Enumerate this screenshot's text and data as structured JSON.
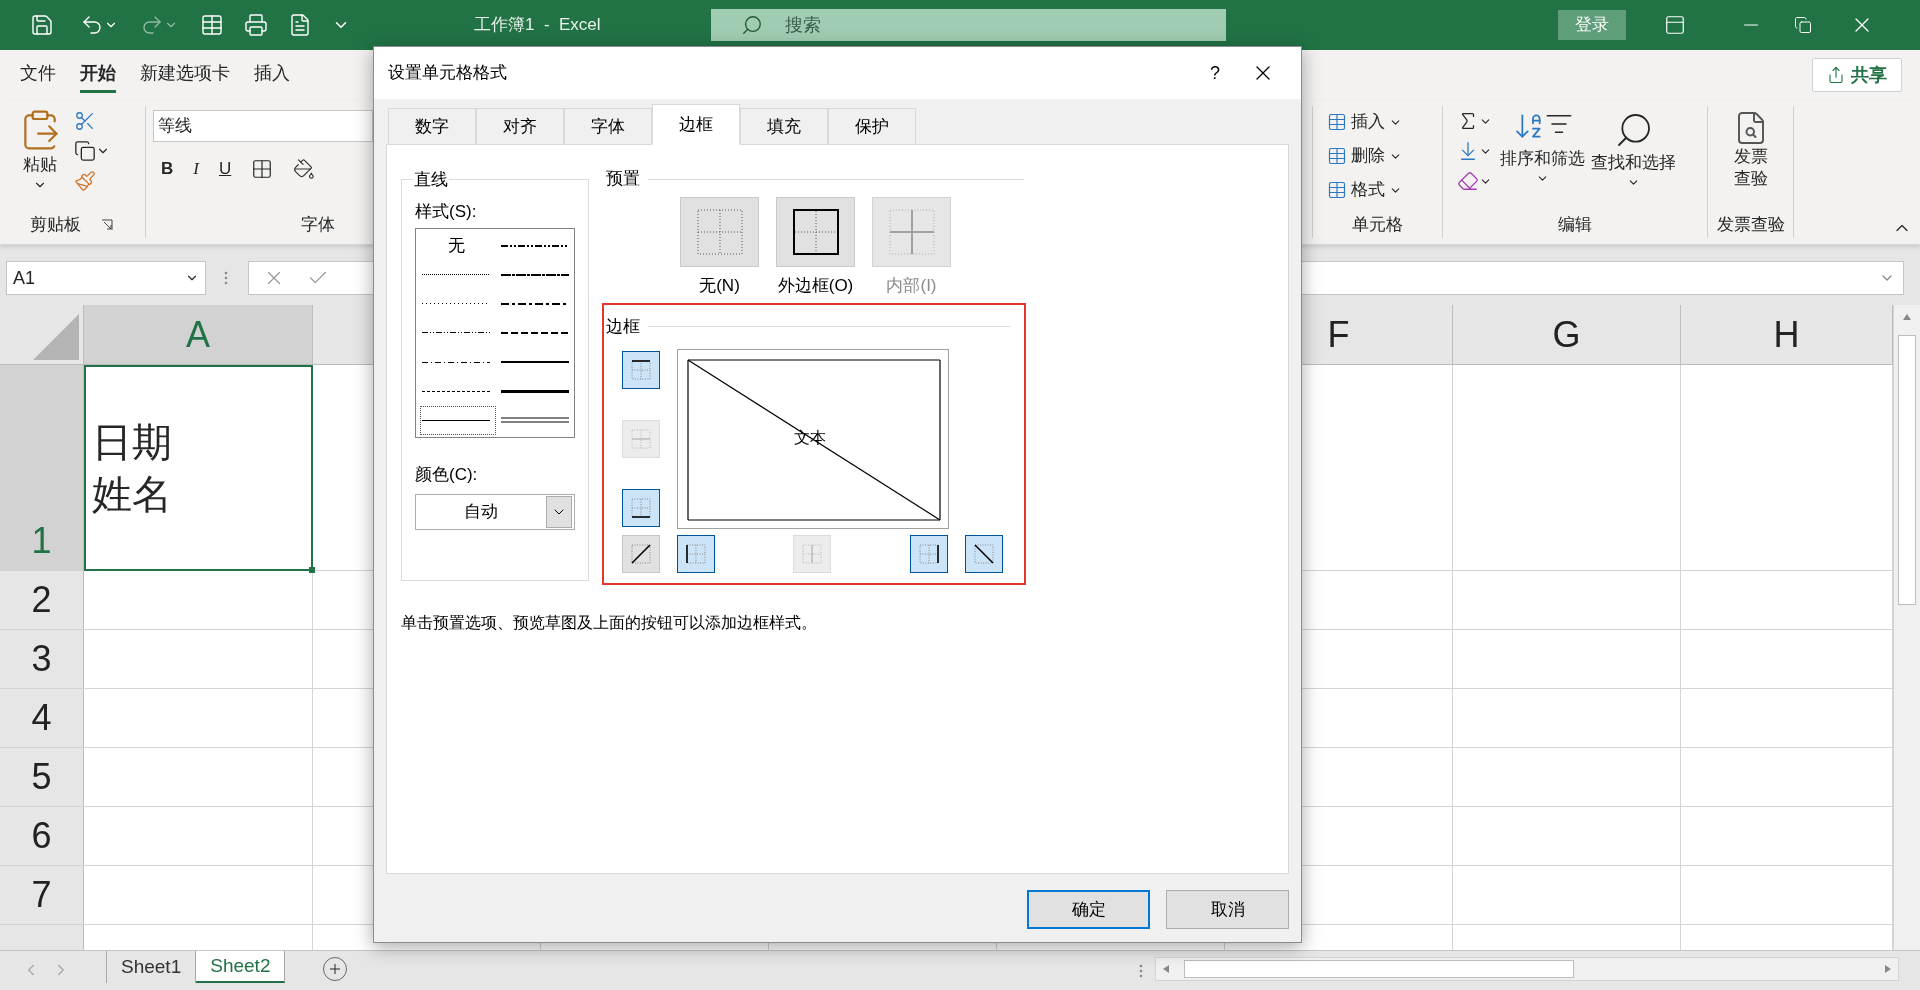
{
  "title_bar": {
    "title": "工作簿1  -  Excel",
    "search": {
      "placeholder": "搜索"
    },
    "sign_in": "登录"
  },
  "ribbon_tabs": [
    {
      "label": "文件",
      "selected": false
    },
    {
      "label": "开始",
      "selected": true
    },
    {
      "label": "新建选项卡",
      "selected": false
    },
    {
      "label": "插入",
      "selected": false
    }
  ],
  "share": "共享",
  "clipboard": {
    "paste": "粘贴",
    "group": "剪贴板"
  },
  "font": {
    "name": "等线",
    "format_buttons": [
      "B",
      "I",
      "U"
    ],
    "group": "字体"
  },
  "cells": {
    "commands": [
      "插入",
      "删除",
      "格式"
    ],
    "group": "单元格"
  },
  "editing": {
    "sort": "排序和筛选",
    "find": "查找和选择",
    "group": "编辑"
  },
  "invoice": {
    "button_lines": [
      "发票",
      "查验"
    ],
    "group": "发票查验"
  },
  "name_box": "A1",
  "sheet": {
    "columns": [
      {
        "label": "A",
        "selected": true
      },
      {
        "label": "F",
        "selected": false
      },
      {
        "label": "G",
        "selected": false
      },
      {
        "label": "H",
        "selected": false
      }
    ],
    "rows": [
      {
        "label": "1",
        "selected": true
      },
      {
        "label": "2",
        "selected": false
      },
      {
        "label": "3",
        "selected": false
      },
      {
        "label": "4",
        "selected": false
      },
      {
        "label": "5",
        "selected": false
      },
      {
        "label": "6",
        "selected": false
      },
      {
        "label": "7",
        "selected": false
      }
    ],
    "cell_a1": [
      "日期",
      "姓名"
    ]
  },
  "sheet_tabs": [
    {
      "label": "Sheet1",
      "selected": false
    },
    {
      "label": "Sheet2",
      "selected": true
    }
  ],
  "dialog": {
    "title": "设置单元格格式",
    "help": "?",
    "tabs": [
      {
        "label": "数字",
        "selected": false
      },
      {
        "label": "对齐",
        "selected": false
      },
      {
        "label": "字体",
        "selected": false
      },
      {
        "label": "边框",
        "selected": true
      },
      {
        "label": "填充",
        "selected": false
      },
      {
        "label": "保护",
        "selected": false
      }
    ],
    "line": {
      "heading": "直线",
      "style_label": "样式(S):",
      "styles": [
        {
          "kind": "none",
          "label": "无",
          "selected": false
        },
        {
          "kind": "hair",
          "selected": false
        },
        {
          "kind": "dotted",
          "selected": false
        },
        {
          "kind": "dash-dot-dot",
          "selected": false
        },
        {
          "kind": "dash-dot",
          "selected": false
        },
        {
          "kind": "dashed",
          "selected": false
        },
        {
          "kind": "thin",
          "selected": true
        },
        {
          "kind": "medium-dash-dot-dot",
          "selected": false
        },
        {
          "kind": "slant-dash-dot",
          "selected": false
        },
        {
          "kind": "medium-dash-dot",
          "selected": false
        },
        {
          "kind": "medium-dashed",
          "selected": false
        },
        {
          "kind": "medium",
          "selected": false
        },
        {
          "kind": "thick",
          "selected": false
        },
        {
          "kind": "double",
          "selected": false
        }
      ],
      "color_label": "颜色(C):",
      "color_value": "自动"
    },
    "presets": {
      "heading": "预置",
      "items": [
        {
          "kind": "none",
          "label": "无(N)",
          "disabled": false
        },
        {
          "kind": "outline",
          "label": "外边框(O)",
          "disabled": false
        },
        {
          "kind": "inside",
          "label": "内部(I)",
          "disabled": true
        }
      ]
    },
    "border": {
      "heading": "边框",
      "preview_text": "文本",
      "buttons": [
        {
          "kind": "top",
          "on": true,
          "disabled": false
        },
        {
          "kind": "inside-horizontal",
          "on": false,
          "disabled": true
        },
        {
          "kind": "bottom",
          "on": true,
          "disabled": false
        },
        {
          "kind": "diagonal-up",
          "on": false,
          "disabled": false
        },
        {
          "kind": "left",
          "on": true,
          "disabled": false
        },
        {
          "kind": "inside-vertical",
          "on": false,
          "disabled": true
        },
        {
          "kind": "right",
          "on": true,
          "disabled": false
        },
        {
          "kind": "diagonal-down",
          "on": true,
          "disabled": false
        }
      ]
    },
    "hint": "单击预置选项、预览草图及上面的按钮可以添加边框样式。",
    "buttons": [
      {
        "label": "确定",
        "kind": "primary"
      },
      {
        "label": "取消",
        "kind": "secondary"
      }
    ]
  }
}
